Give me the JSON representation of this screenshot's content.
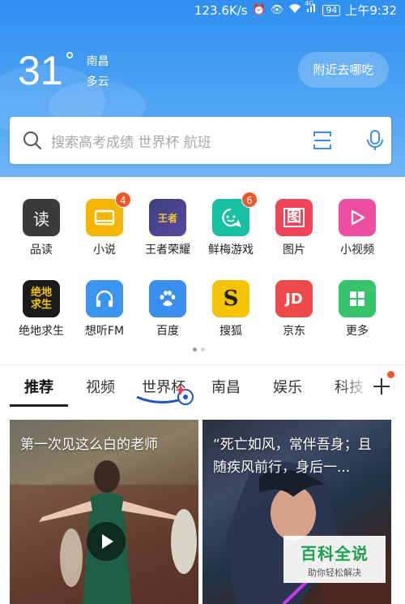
{
  "status_bar": {
    "speed": "123.6K/s",
    "signal": "4G",
    "battery": "94",
    "time": "上午9:32"
  },
  "weather": {
    "temperature": "31",
    "degree_symbol": "°",
    "city": "南昌",
    "condition": "多云"
  },
  "nearby_button": "附近去哪吃",
  "search": {
    "placeholder": "搜索高考成绩 世界杯 航班"
  },
  "apps": [
    {
      "label": "品读",
      "glyph": "读",
      "color": "#3a3a3a",
      "icon": "read-icon"
    },
    {
      "label": "小说",
      "glyph": "",
      "color": "#f5b400",
      "icon": "book-icon",
      "badge": "4"
    },
    {
      "label": "王者荣耀",
      "glyph": "王者",
      "color": "#3c3f7c",
      "icon": "honor-of-kings-icon"
    },
    {
      "label": "鲜梅游戏",
      "glyph": "",
      "color": "#17c0a0",
      "icon": "game-face-icon",
      "badge": "6"
    },
    {
      "label": "图片",
      "glyph": "图",
      "color": "#f0445a",
      "icon": "picture-icon"
    },
    {
      "label": "小视频",
      "glyph": "",
      "color": "#ef4fa0",
      "icon": "play-triangle-icon"
    },
    {
      "label": "绝地求生",
      "glyph": "绝地\n求生",
      "color": "#1b1b1b",
      "icon": "pubg-icon"
    },
    {
      "label": "想听FM",
      "glyph": "",
      "color": "#3a94f0",
      "icon": "headphones-icon"
    },
    {
      "label": "百度",
      "glyph": "",
      "color": "#3a8ff0",
      "icon": "paw-icon"
    },
    {
      "label": "搜狐",
      "glyph": "S",
      "color": "#f5c400",
      "icon": "sohu-icon"
    },
    {
      "label": "京东",
      "glyph": "JD",
      "color": "#f04a4a",
      "icon": "jd-icon"
    },
    {
      "label": "更多",
      "glyph": "",
      "color": "#35c46a",
      "icon": "more-grid-icon"
    }
  ],
  "tabs": [
    "推荐",
    "视频",
    "世界杯",
    "南昌",
    "娱乐",
    "科技"
  ],
  "cards": [
    {
      "title": "第一次见这么白的老师"
    },
    {
      "title": "“死亡如风，常伴吾身；且随疾风前行，身后一..."
    }
  ],
  "watermark": {
    "main": "百科全说",
    "sub": "助你轻松解决"
  }
}
